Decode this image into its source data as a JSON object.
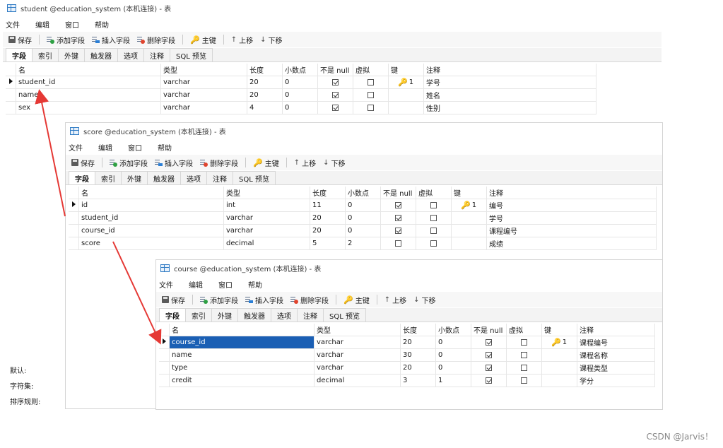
{
  "menu": [
    "文件",
    "编辑",
    "窗口",
    "帮助"
  ],
  "toolbar": {
    "save": "保存",
    "add_field": "添加字段",
    "insert_field": "插入字段",
    "delete_field": "删除字段",
    "primary_key": "主键",
    "move_up": "上移",
    "move_down": "下移"
  },
  "tabs": [
    "字段",
    "索引",
    "外键",
    "触发器",
    "选项",
    "注释",
    "SQL 预览"
  ],
  "columns": [
    "名",
    "类型",
    "长度",
    "小数点",
    "不是 null",
    "虚拟",
    "键",
    "注释"
  ],
  "windows": [
    {
      "title": "student @education_system (本机连接) - 表",
      "rows": [
        {
          "name": "student_id",
          "type": "varchar",
          "length": "20",
          "decimals": "0",
          "not_null": true,
          "virtual": false,
          "key": "1",
          "comment": "学号",
          "current": true
        },
        {
          "name": "name",
          "type": "varchar",
          "length": "20",
          "decimals": "0",
          "not_null": true,
          "virtual": false,
          "key": "",
          "comment": "姓名",
          "current": false
        },
        {
          "name": "sex",
          "type": "varchar",
          "length": "4",
          "decimals": "0",
          "not_null": true,
          "virtual": false,
          "key": "",
          "comment": "性别",
          "current": false
        }
      ]
    },
    {
      "title": "score @education_system (本机连接) - 表",
      "rows": [
        {
          "name": "id",
          "type": "int",
          "length": "11",
          "decimals": "0",
          "not_null": true,
          "virtual": false,
          "key": "1",
          "comment": "编号",
          "current": true
        },
        {
          "name": "student_id",
          "type": "varchar",
          "length": "20",
          "decimals": "0",
          "not_null": true,
          "virtual": false,
          "key": "",
          "comment": "学号",
          "current": false
        },
        {
          "name": "course_id",
          "type": "varchar",
          "length": "20",
          "decimals": "0",
          "not_null": true,
          "virtual": false,
          "key": "",
          "comment": "课程编号",
          "current": false
        },
        {
          "name": "score",
          "type": "decimal",
          "length": "5",
          "decimals": "2",
          "not_null": false,
          "virtual": false,
          "key": "",
          "comment": "成绩",
          "current": false
        }
      ]
    },
    {
      "title": "course @education_system (本机连接) - 表",
      "rows": [
        {
          "name": "course_id",
          "type": "varchar",
          "length": "20",
          "decimals": "0",
          "not_null": true,
          "virtual": false,
          "key": "1",
          "comment": "课程编号",
          "current": true,
          "selected": true
        },
        {
          "name": "name",
          "type": "varchar",
          "length": "30",
          "decimals": "0",
          "not_null": true,
          "virtual": false,
          "key": "",
          "comment": "课程名称",
          "current": false
        },
        {
          "name": "type",
          "type": "varchar",
          "length": "20",
          "decimals": "0",
          "not_null": true,
          "virtual": false,
          "key": "",
          "comment": "课程类型",
          "current": false
        },
        {
          "name": "credit",
          "type": "decimal",
          "length": "3",
          "decimals": "1",
          "not_null": true,
          "virtual": false,
          "key": "",
          "comment": "学分",
          "current": false
        }
      ]
    }
  ],
  "properties": {
    "default": "默认:",
    "charset": "字符集:",
    "collation": "排序规则:"
  },
  "watermark": "CSDN @Jarvis！",
  "colors": {
    "annotation_arrow": "#e53935",
    "selection": "#1a5fb4",
    "key_icon": "#d4a017"
  }
}
